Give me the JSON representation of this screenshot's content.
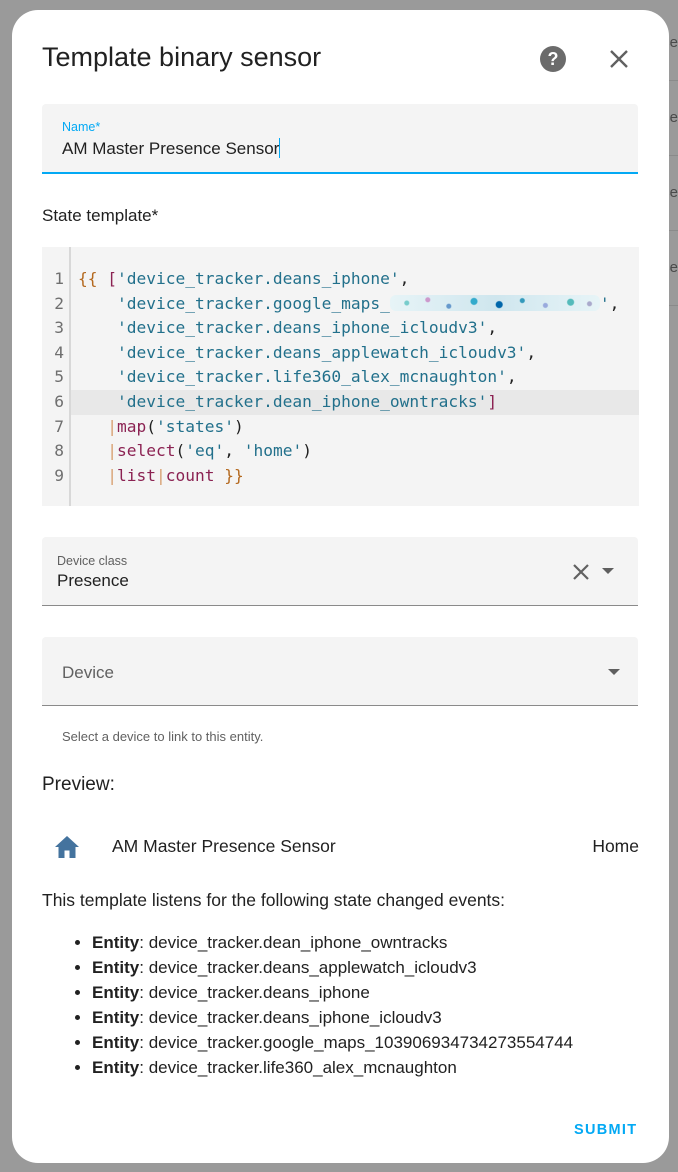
{
  "background": {
    "row_fragments": [
      "se",
      "se",
      "se",
      "se"
    ]
  },
  "dialog": {
    "title": "Template binary sensor",
    "help_icon": "help-circle-icon",
    "close_icon": "close-icon"
  },
  "name_field": {
    "label": "Name*",
    "value": "AM Master Presence Sensor"
  },
  "state_template": {
    "label": "State template*",
    "line_numbers": [
      "1",
      "2",
      "3",
      "4",
      "5",
      "6",
      "7",
      "8",
      "9"
    ],
    "active_line": 6
  },
  "device_class": {
    "label": "Device class",
    "value": "Presence",
    "clear_icon": "close-icon",
    "arrow_icon": "menu-down-icon"
  },
  "device": {
    "placeholder": "Device",
    "helper": "Select a device to link to this entity.",
    "arrow_icon": "menu-down-icon"
  },
  "preview": {
    "title": "Preview:",
    "icon": "home-icon",
    "entity_name": "AM Master Presence Sensor",
    "state": "Home"
  },
  "listeners": {
    "intro": "This template listens for the following state changed events:",
    "label": "Entity",
    "items": [
      "device_tracker.dean_iphone_owntracks",
      "device_tracker.deans_applewatch_icloudv3",
      "device_tracker.deans_iphone",
      "device_tracker.deans_iphone_icloudv3",
      "device_tracker.google_maps_103906934734273554744",
      "device_tracker.life360_alex_mcnaughton"
    ]
  },
  "actions": {
    "submit": "SUBMIT"
  },
  "colors": {
    "accent": "#03a9f4",
    "home_icon": "#44739e",
    "string": "#22708b",
    "keyword": "#8b2252",
    "bracket": "#b4691f"
  }
}
